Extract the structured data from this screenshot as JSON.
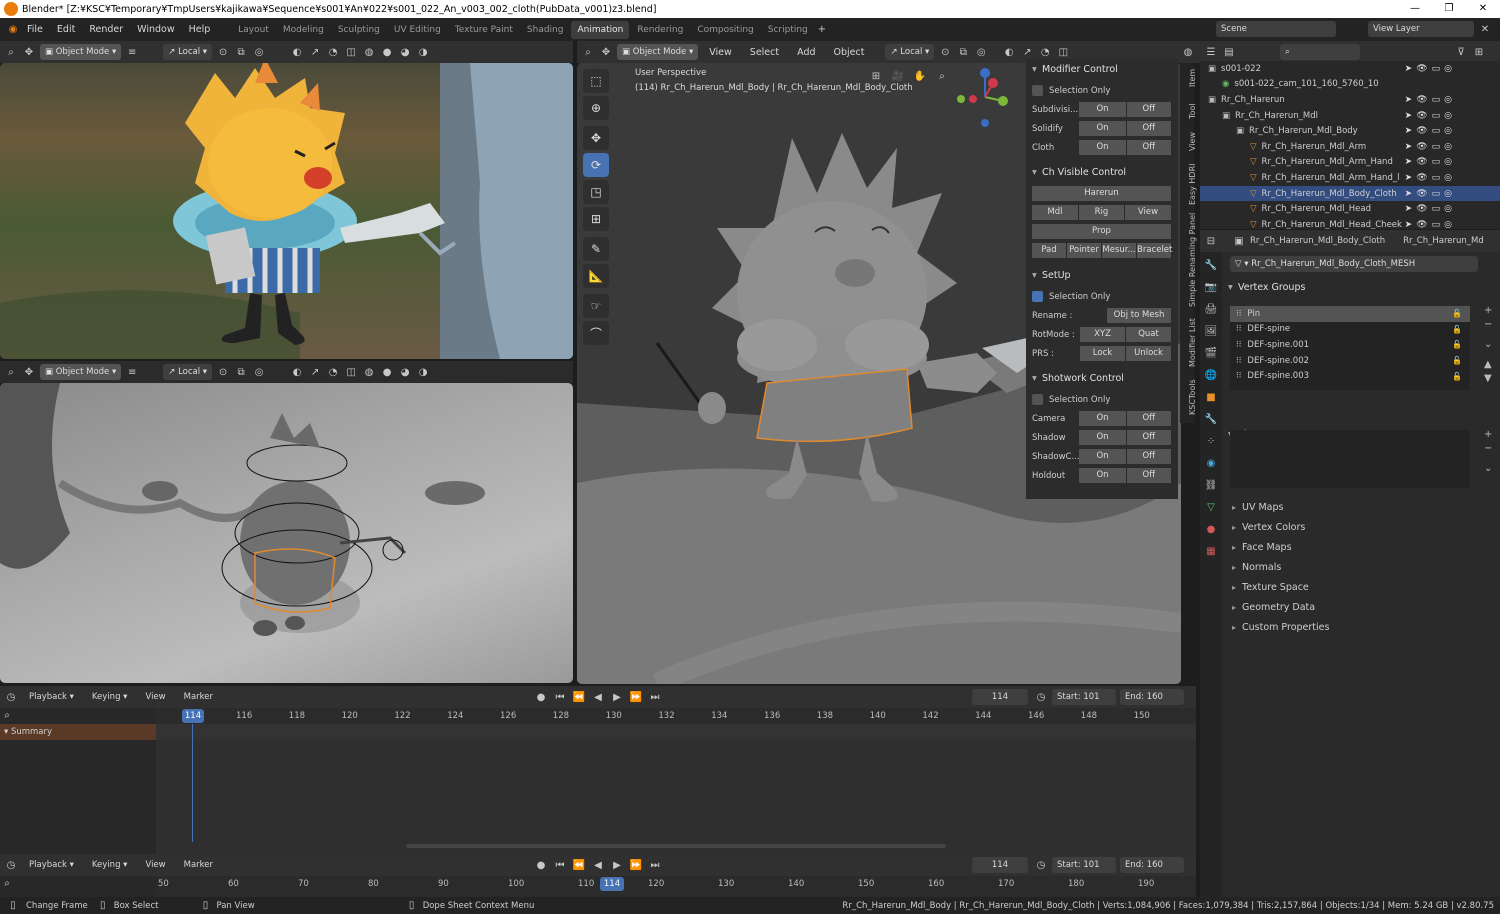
{
  "title": "Blender* [Z:¥KSC¥Temporary¥TmpUsers¥kajikawa¥Sequence¥s001¥An¥022¥s001_022_An_v003_002_cloth(PubData_v001)z3.blend]",
  "menus": [
    "File",
    "Edit",
    "Render",
    "Window",
    "Help"
  ],
  "workspaces": [
    "Layout",
    "Modeling",
    "Sculpting",
    "UV Editing",
    "Texture Paint",
    "Shading",
    "Animation",
    "Rendering",
    "Compositing",
    "Scripting"
  ],
  "active_workspace": "Animation",
  "scene": "Scene",
  "view_layer": "View Layer",
  "vp_header": {
    "mode": "Object Mode",
    "orient": "Local",
    "view": "View",
    "select": "Select",
    "add": "Add",
    "object": "Object"
  },
  "main_vp": {
    "perspective": "User Perspective",
    "object_info": "(114) Rr_Ch_Harerun_Mdl_Body | Rr_Ch_Harerun_Mdl_Body_Cloth"
  },
  "npanel": {
    "modifier": {
      "title": "Modifier Control",
      "sel_only": "Selection Only",
      "rows": [
        {
          "label": "Subdivisi...",
          "on": "On",
          "off": "Off"
        },
        {
          "label": "Solidify",
          "on": "On",
          "off": "Off"
        },
        {
          "label": "Cloth",
          "on": "On",
          "off": "Off"
        }
      ]
    },
    "chvis": {
      "title": "Ch Visible Control",
      "row1": "Harerun",
      "row2": [
        "Mdl",
        "Rig",
        "View"
      ],
      "row3": "Prop",
      "row4": [
        "Pad",
        "Pointer",
        "Mesur...",
        "Bracelet"
      ]
    },
    "setup": {
      "title": "SetUp",
      "sel_only": "Selection Only",
      "rename_label": "Rename :",
      "rename_btn": "Obj to Mesh",
      "rotmode_label": "RotMode :",
      "rot": [
        "XYZ",
        "Quat"
      ],
      "prs_label": "PRS :",
      "prs": [
        "Lock",
        "Unlock"
      ]
    },
    "shotwork": {
      "title": "Shotwork Control",
      "sel_only": "Selection Only",
      "rows": [
        {
          "label": "Camera",
          "on": "On",
          "off": "Off"
        },
        {
          "label": "Shadow",
          "on": "On",
          "off": "Off"
        },
        {
          "label": "ShadowC...",
          "on": "On",
          "off": "Off"
        },
        {
          "label": "Holdout",
          "on": "On",
          "off": "Off"
        }
      ]
    }
  },
  "side_tabs": [
    "Item",
    "Tool",
    "View",
    "Easy HDRI",
    "Simple Renaming Panel",
    "Modifier List",
    "KSCTools"
  ],
  "outliner": [
    {
      "name": "s001-022",
      "depth": 0,
      "icon": "▣"
    },
    {
      "name": "s001-022_cam_101_160_5760_10",
      "depth": 1,
      "icon": "◉"
    },
    {
      "name": "Rr_Ch_Harerun",
      "depth": 0,
      "icon": "▣"
    },
    {
      "name": "Rr_Ch_Harerun_Mdl",
      "depth": 1,
      "icon": "▣"
    },
    {
      "name": "Rr_Ch_Harerun_Mdl_Body",
      "depth": 2,
      "icon": "▣"
    },
    {
      "name": "Rr_Ch_Harerun_Mdl_Arm",
      "depth": 3,
      "icon": "▽"
    },
    {
      "name": "Rr_Ch_Harerun_Mdl_Arm_Hand",
      "depth": 3,
      "icon": "▽"
    },
    {
      "name": "Rr_Ch_Harerun_Mdl_Arm_Hand_l",
      "depth": 3,
      "icon": "▽"
    },
    {
      "name": "Rr_Ch_Harerun_Mdl_Body_Cloth",
      "depth": 3,
      "icon": "▽",
      "sel": true
    },
    {
      "name": "Rr_Ch_Harerun_Mdl_Head",
      "depth": 3,
      "icon": "▽"
    },
    {
      "name": "Rr_Ch_Harerun_Mdl_Head_Cheek",
      "depth": 3,
      "icon": "▽"
    }
  ],
  "props": {
    "breadcrumb_obj": "Rr_Ch_Harerun_Mdl_Body_Cloth",
    "breadcrumb_mesh": "Rr_Ch_Harerun_Md",
    "mesh_name": "Rr_Ch_Harerun_Mdl_Body_Cloth_MESH",
    "vertex_groups_title": "Vertex Groups",
    "vertex_groups": [
      "Pin",
      "DEF-spine",
      "DEF-spine.001",
      "DEF-spine.002",
      "DEF-spine.003"
    ],
    "shape_keys_title": "Shape Keys",
    "sections": [
      "UV Maps",
      "Vertex Colors",
      "Face Maps",
      "Normals",
      "Texture Space",
      "Geometry Data",
      "Custom Properties"
    ]
  },
  "timeline1": {
    "menus": [
      "Playback",
      "Keying",
      "View",
      "Marker"
    ],
    "frame": "114",
    "start_label": "Start:",
    "start": "101",
    "end_label": "End:",
    "end": "160",
    "ticks": [
      "116",
      "118",
      "120",
      "122",
      "124",
      "126",
      "128",
      "130",
      "132",
      "134",
      "136",
      "138",
      "140",
      "142",
      "144",
      "146",
      "148",
      "150"
    ],
    "summary": "Summary"
  },
  "timeline2": {
    "ticks": [
      "50",
      "60",
      "70",
      "80",
      "90",
      "100",
      "110",
      "120",
      "130",
      "140",
      "150",
      "160",
      "170",
      "180",
      "190"
    ]
  },
  "status": {
    "change_frame": "Change Frame",
    "box_select": "Box Select",
    "pan_view": "Pan View",
    "context_menu": "Dope Sheet Context Menu",
    "stats": "Rr_Ch_Harerun_Mdl_Body | Rr_Ch_Harerun_Mdl_Body_Cloth | Verts:1,084,906 | Faces:1,079,384 | Tris:2,157,864 | Objects:1/34 | Mem: 5.24 GB | v2.80.75"
  }
}
